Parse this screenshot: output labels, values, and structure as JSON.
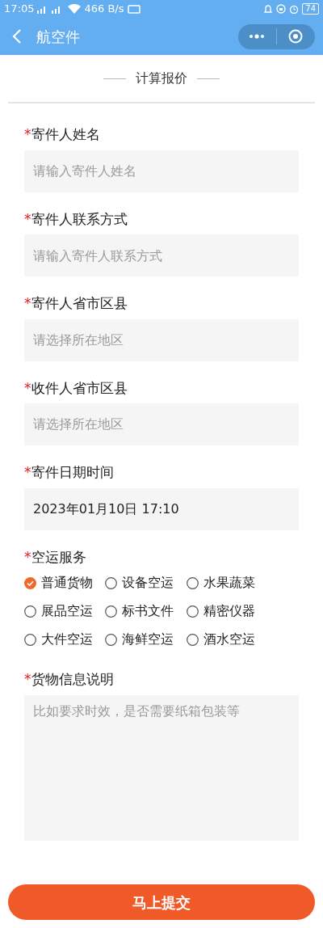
{
  "status_bar": {
    "time": "17:05",
    "speed": "466 B/s",
    "battery": "74"
  },
  "header": {
    "title": "航空件"
  },
  "section": {
    "title": "计算报价"
  },
  "fields": [
    {
      "kind": "input",
      "label": "寄件人姓名",
      "required": "*",
      "placeholder": "请输入寄件人姓名"
    },
    {
      "kind": "input",
      "label": "寄件人联系方式",
      "required": "*",
      "placeholder": "请输入寄件人联系方式"
    },
    {
      "kind": "select",
      "label": "寄件人省市区县",
      "required": "*",
      "placeholder": "请选择所在地区"
    },
    {
      "kind": "select",
      "label": "收件人省市区县",
      "required": "*",
      "placeholder": "请选择所在地区"
    },
    {
      "kind": "value",
      "label": "寄件日期时间",
      "required": "*",
      "value": "2023年01月10日 17:10"
    }
  ],
  "service": {
    "label": "空运服务",
    "required": "*",
    "options": [
      {
        "label": "普通货物",
        "selected": true
      },
      {
        "label": "设备空运",
        "selected": false
      },
      {
        "label": "水果蔬菜",
        "selected": false
      },
      {
        "label": "展品空运",
        "selected": false
      },
      {
        "label": "标书文件",
        "selected": false
      },
      {
        "label": "精密仪器",
        "selected": false
      },
      {
        "label": "大件空运",
        "selected": false
      },
      {
        "label": "海鲜空运",
        "selected": false
      },
      {
        "label": "酒水空运",
        "selected": false
      }
    ]
  },
  "description": {
    "label": "货物信息说明",
    "required": "*",
    "placeholder": "比如要求时效，是否需要纸箱包装等"
  },
  "submit": {
    "label": "马上提交"
  }
}
